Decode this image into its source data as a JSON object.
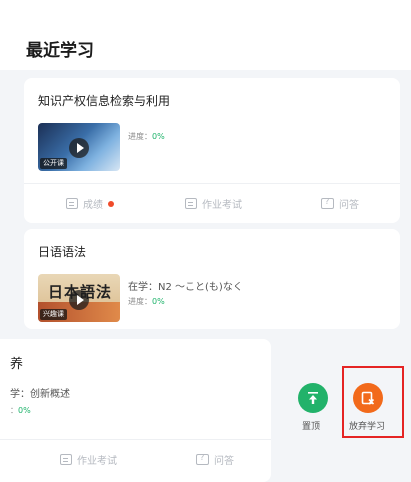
{
  "page": {
    "title": "最近学习"
  },
  "courses": [
    {
      "title": "知识产权信息检索与利用",
      "thumb_tag": "公开课",
      "progress_label": "进度：",
      "progress_value": "0%",
      "actions": {
        "grades": "成绩",
        "homework": "作业考试",
        "qa": "问答"
      }
    },
    {
      "title": "日语语法",
      "thumb_text": "日本語法",
      "thumb_tag": "兴趣课",
      "studying_label": "在学：",
      "studying_value": "N2 ～こと(も)なく",
      "progress_label": "进度：",
      "progress_value": "0%"
    },
    {
      "title_partial": "养",
      "studying_partial": "学：创新概述",
      "progress_partial": "：",
      "progress_value": "0%",
      "actions": {
        "homework": "作业考试",
        "qa": "问答"
      }
    }
  ],
  "swipe_actions": {
    "pin": "置顶",
    "quit": "放弃学习"
  },
  "colors": {
    "green": "#22b26a",
    "orange": "#f26a1b",
    "highlight": "#e52424",
    "dot": "#f04b2a"
  }
}
